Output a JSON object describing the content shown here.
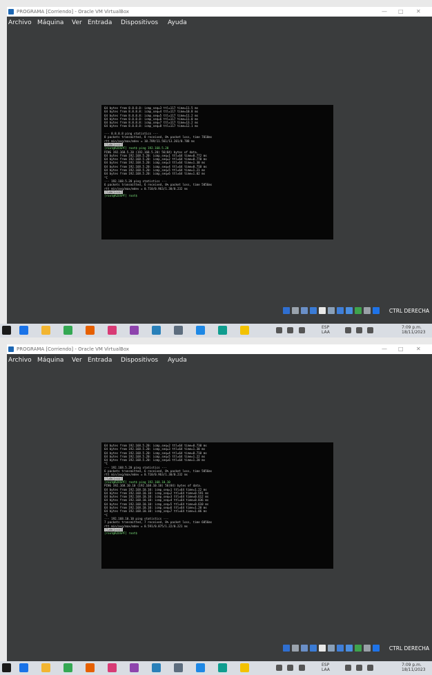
{
  "window": {
    "title": "PROGRAMA [Corriendo] - Oracle VM VirtualBox",
    "controls": [
      "—",
      "□",
      "✕"
    ]
  },
  "menu": [
    "Archivo",
    "Máquina",
    "Ver",
    "Entrada",
    "Dispositivos",
    "Ayuda"
  ],
  "host_key": "CTRL DERECHA",
  "screens": [
    {
      "lines": [
        {
          "t": "64 bytes from 8.8.8.8: icmp_seq=3 ttl=117 time=11.5 ms",
          "k": "out"
        },
        {
          "t": "64 bytes from 8.8.8.8: icmp_seq=4 ttl=117 time=10.8 ms",
          "k": "out"
        },
        {
          "t": "64 bytes from 8.8.8.8: icmp_seq=5 ttl=117 time=11.2 ms",
          "k": "out"
        },
        {
          "t": "64 bytes from 8.8.8.8: icmp_seq=6 ttl=117 time=11.0 ms",
          "k": "out"
        },
        {
          "t": "64 bytes from 8.8.8.8: icmp_seq=7 ttl=117 time=13.2 ms",
          "k": "out"
        },
        {
          "t": "64 bytes from 8.8.8.8: icmp_seq=8 ttl=117 time=12.1 ms",
          "k": "out"
        },
        {
          "t": "",
          "k": "out"
        },
        {
          "t": "--- 8.8.8.8 ping statistics ---",
          "k": "out"
        },
        {
          "t": "8 packets transmitted, 8 received, 0% packet loss, time 7010ms",
          "k": "out"
        },
        {
          "t": "rtt min/avg/max/mdev = 10.789/11.561/13.201/0.788 ms",
          "k": "out"
        },
        {
          "t": "[labcisco]",
          "k": "hl"
        },
        {
          "t": "[root@R2OSPF] root$ ping 192.168.5.20",
          "k": "prompt"
        },
        {
          "t": "PING 192.168.5.20 (192.168.5.20) 56(84) bytes of data.",
          "k": "out"
        },
        {
          "t": "64 bytes from 192.168.5.20: icmp_seq=1 ttl=64 time=0.772 ms",
          "k": "out"
        },
        {
          "t": "64 bytes from 192.168.5.20: icmp_seq=2 ttl=64 time=0.770 ms",
          "k": "out"
        },
        {
          "t": "64 bytes from 192.168.5.20: icmp_seq=3 ttl=64 time=1.30 ms",
          "k": "out"
        },
        {
          "t": "64 bytes from 192.168.5.20: icmp_seq=4 ttl=64 time=0.710 ms",
          "k": "out"
        },
        {
          "t": "64 bytes from 192.168.5.20: icmp_seq=5 ttl=64 time=1.21 ms",
          "k": "out"
        },
        {
          "t": "64 bytes from 192.168.5.20: icmp_seq=6 ttl=64 time=1.02 ms",
          "k": "out"
        },
        {
          "t": "^C",
          "k": "out"
        },
        {
          "t": "--- 192.168.5.20 ping statistics ---",
          "k": "out"
        },
        {
          "t": "6 packets transmitted, 6 received, 0% packet loss, time 5056ms",
          "k": "out"
        },
        {
          "t": "rtt min/avg/max/mdev = 0.710/0.963/1.30/0.232 ms",
          "k": "out"
        },
        {
          "t": "[labcisco]",
          "k": "hl"
        },
        {
          "t": "[root@R2OSPF] root$",
          "k": "prompt"
        }
      ]
    },
    {
      "lines": [
        {
          "t": "64 bytes from 192.168.5.20: icmp_seq=2 ttl=64 time=0.730 ms",
          "k": "out"
        },
        {
          "t": "64 bytes from 192.168.5.20: icmp_seq=3 ttl=64 time=1.30 ms",
          "k": "out"
        },
        {
          "t": "64 bytes from 192.168.5.20: icmp_seq=4 ttl=64 time=0.710 ms",
          "k": "out"
        },
        {
          "t": "64 bytes from 192.168.5.20: icmp_seq=5 ttl=64 time=1.22 ms",
          "k": "out"
        },
        {
          "t": "64 bytes from 192.168.5.20: icmp_seq=6 ttl=64 time=1.20 ms",
          "k": "out"
        },
        {
          "t": "^C",
          "k": "out"
        },
        {
          "t": "--- 192.168.5.20 ping statistics ---",
          "k": "out"
        },
        {
          "t": "6 packets transmitted, 6 received, 0% packet loss, time 5056ms",
          "k": "out"
        },
        {
          "t": "rtt min/avg/max/mdev = 0.710/0.963/1.30/0.232 ms",
          "k": "out"
        },
        {
          "t": "[labcisco]",
          "k": "hl"
        },
        {
          "t": "[root@R2OSPF] root$ ping 192.168.10.10",
          "k": "prompt"
        },
        {
          "t": "PING 192.168.10.10 (192.168.10.10) 56(84) bytes of data.",
          "k": "out"
        },
        {
          "t": "64 bytes from 192.168.10.10: icmp_seq=1 ttl=64 time=1.22 ms",
          "k": "out"
        },
        {
          "t": "64 bytes from 192.168.10.10: icmp_seq=2 ttl=64 time=0.591 ms",
          "k": "out"
        },
        {
          "t": "64 bytes from 192.168.10.10: icmp_seq=3 ttl=64 time=0.612 ms",
          "k": "out"
        },
        {
          "t": "64 bytes from 192.168.10.10: icmp_seq=4 ttl=64 time=0.836 ms",
          "k": "out"
        },
        {
          "t": "64 bytes from 192.168.10.10: icmp_seq=5 ttl=64 time=0.610 ms",
          "k": "out"
        },
        {
          "t": "64 bytes from 192.168.10.10: icmp_seq=6 ttl=64 time=1.20 ms",
          "k": "out"
        },
        {
          "t": "64 bytes from 192.168.10.10: icmp_seq=7 ttl=64 time=1.06 ms",
          "k": "out"
        },
        {
          "t": "^C",
          "k": "out"
        },
        {
          "t": "--- 192.168.10.10 ping statistics ---",
          "k": "out"
        },
        {
          "t": "7 packets transmitted, 7 received, 0% packet loss, time 6056ms",
          "k": "out"
        },
        {
          "t": "rtt min/avg/max/mdev = 0.591/0.875/1.22/0.221 ms",
          "k": "out"
        },
        {
          "t": "[labcisco]",
          "k": "hl"
        },
        {
          "t": "[root@R2OSPF] root$",
          "k": "prompt"
        }
      ]
    }
  ],
  "vm_tray_icons": [
    {
      "name": "hard-disk-icon",
      "color": "#2f6fd1"
    },
    {
      "name": "optical-drive-icon",
      "color": "#9aa3ad"
    },
    {
      "name": "audio-icon",
      "color": "#6a8fc7"
    },
    {
      "name": "network-icon",
      "color": "#3a7bd5"
    },
    {
      "name": "usb-icon",
      "color": "#e8e8e8"
    },
    {
      "name": "shared-folders-icon",
      "color": "#8aa0b8"
    },
    {
      "name": "display-icon",
      "color": "#3f7fd9"
    },
    {
      "name": "video-capture-icon",
      "color": "#4b8ee0"
    },
    {
      "name": "cpu-icon",
      "color": "#3fa34d"
    },
    {
      "name": "mouse-integration-icon",
      "color": "#9aa0a8"
    },
    {
      "name": "keyboard-icon",
      "color": "#1e73e8"
    }
  ],
  "taskbar": {
    "apps": [
      {
        "name": "file-explorer-icon",
        "color": "#1a73e8"
      },
      {
        "name": "folder-icon",
        "color": "#f2b531"
      },
      {
        "name": "chrome-icon",
        "color": "#34a853"
      },
      {
        "name": "firefox-icon",
        "color": "#e66000"
      },
      {
        "name": "paint-icon",
        "color": "#d83b75"
      },
      {
        "name": "photos-icon",
        "color": "#8e44ad"
      },
      {
        "name": "store-icon",
        "color": "#2980b9"
      },
      {
        "name": "settings-icon",
        "color": "#5d6d7e"
      },
      {
        "name": "mail-icon",
        "color": "#1e88e5"
      },
      {
        "name": "edge-icon",
        "color": "#0f9d8f"
      },
      {
        "name": "virtualbox-icon",
        "color": "#f3c200"
      }
    ],
    "lang": "ESP",
    "lang_region": "LAA",
    "time": "7:09 p.m.",
    "date": "18/11/2023"
  }
}
